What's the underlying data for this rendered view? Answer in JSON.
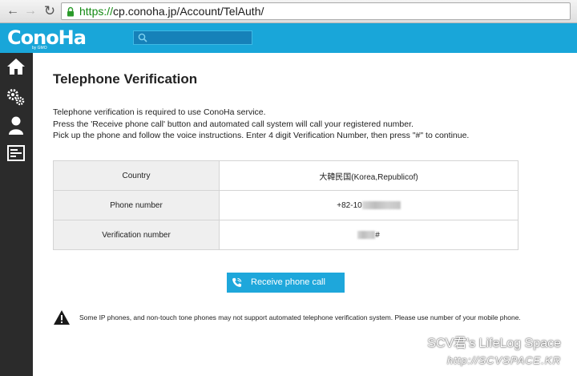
{
  "browser": {
    "url_scheme": "https://",
    "url_rest": "cp.conoha.jp/Account/TelAuth/"
  },
  "header": {
    "logo": "ConoHa",
    "logo_sub": "by GMO",
    "brand_color": "#19a6d9"
  },
  "sidebar": {
    "items": [
      {
        "icon": "home-icon"
      },
      {
        "icon": "gears-icon"
      },
      {
        "icon": "user-icon"
      },
      {
        "icon": "console-icon"
      }
    ]
  },
  "main": {
    "title": "Telephone Verification",
    "intro": [
      "Telephone verification is required to use ConoHa service.",
      "Press the 'Receive phone call' button and automated call system will call your registered number.",
      "Pick up the phone and follow the voice instructions. Enter 4 digit Verification Number, then press \"#\" to continue."
    ],
    "table": {
      "rows": [
        {
          "label": "Country",
          "value": "大韓民国(Korea,Republicof)"
        },
        {
          "label": "Phone number",
          "value": "+82-10"
        },
        {
          "label": "Verification number",
          "value": "#"
        }
      ]
    },
    "call_button": "Receive phone call",
    "notice": "Some IP phones, and non-touch tone phones may not support automated telephone verification system. Please use number of your mobile phone."
  },
  "watermark": {
    "line1": "SCV君's LifeLog Space",
    "line2": "http://SCVSPACE.KR"
  }
}
